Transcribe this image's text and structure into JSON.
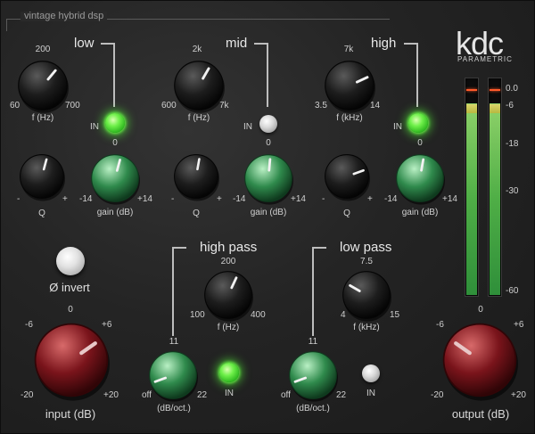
{
  "header": {
    "tagline": "vintage hybrid dsp",
    "brand": "kdc",
    "brand_sub": "PARAMETRIC"
  },
  "bands": {
    "low": {
      "title": "low",
      "freq_label": "f (Hz)",
      "freq_min": "60",
      "freq_mid": "200",
      "freq_max": "700",
      "in_label": "IN",
      "in_state": "on",
      "q_label": "Q",
      "q_minus": "-",
      "q_plus": "+",
      "gain_label": "gain (dB)",
      "gain_min": "-14",
      "gain_zero": "0",
      "gain_max": "+14"
    },
    "mid": {
      "title": "mid",
      "freq_label": "f (Hz)",
      "freq_min": "600",
      "freq_mid": "2k",
      "freq_max": "7k",
      "in_label": "IN",
      "in_state": "off",
      "q_label": "Q",
      "q_minus": "-",
      "q_plus": "+",
      "gain_label": "gain (dB)",
      "gain_min": "-14",
      "gain_zero": "0",
      "gain_max": "+14"
    },
    "high": {
      "title": "high",
      "freq_label": "f (kHz)",
      "freq_min": "3.5",
      "freq_mid": "7k",
      "freq_max": "14",
      "in_label": "IN",
      "in_state": "on",
      "q_label": "Q",
      "q_minus": "-",
      "q_plus": "+",
      "gain_label": "gain (dB)",
      "gain_min": "-14",
      "gain_zero": "0",
      "gain_max": "+14"
    }
  },
  "highpass": {
    "title": "high pass",
    "freq_label": "f (Hz)",
    "freq_min": "100",
    "freq_mid": "200",
    "freq_max": "400",
    "slope_label": "(dB/oct.)",
    "slope_off": "off",
    "slope_mid": "11",
    "slope_max": "22",
    "in_label": "IN",
    "in_state": "on"
  },
  "lowpass": {
    "title": "low pass",
    "freq_label": "f (kHz)",
    "freq_min": "4",
    "freq_mid": "7.5",
    "freq_max": "15",
    "slope_label": "(dB/oct.)",
    "slope_off": "off",
    "slope_mid": "11",
    "slope_max": "22",
    "in_label": "IN",
    "in_state": "off"
  },
  "phase": {
    "label": "Ø invert"
  },
  "input": {
    "label": "input (dB)",
    "min": "-20",
    "m6": "-6",
    "zero": "0",
    "p6": "+6",
    "max": "+20"
  },
  "output": {
    "label": "output (dB)",
    "min": "-20",
    "m6": "-6",
    "zero": "0",
    "p6": "+6",
    "max": "+20"
  },
  "meter": {
    "scale": [
      "0.0",
      "-6",
      "-18",
      "-30",
      "-60"
    ],
    "left_level": 0.88,
    "right_level": 0.88
  },
  "colors": {
    "led_on": "#5df03c",
    "peak": "#ff5a2a",
    "meter_green": "#4fae46",
    "knob_green": "#3c9a5a",
    "knob_red": "#8a1c22"
  }
}
